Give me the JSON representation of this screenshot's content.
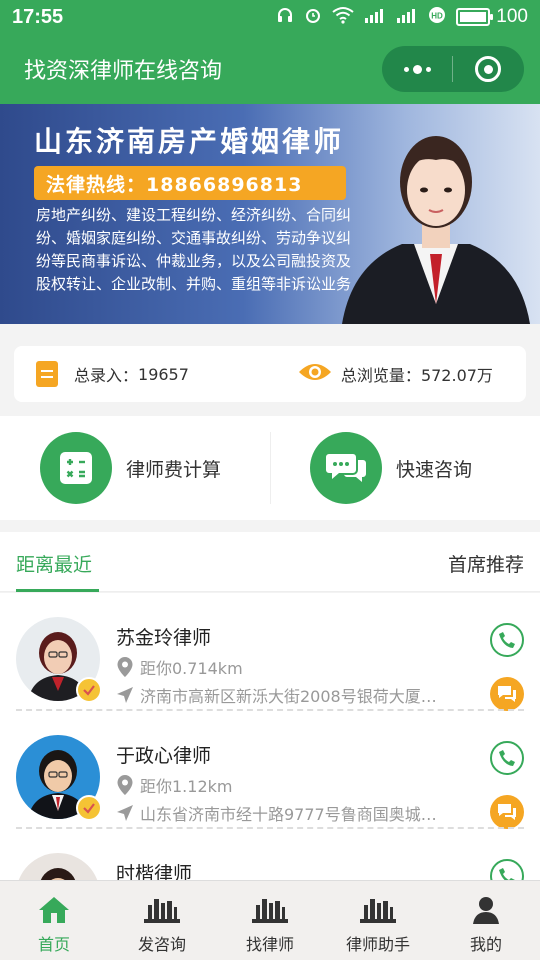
{
  "status_bar": {
    "time": "17:55",
    "battery": "100"
  },
  "header": {
    "title": "找资深律师在线咨询"
  },
  "banner": {
    "title": "山东济南房产婚姻律师",
    "hotline": "法律热线：18866896813",
    "description": "房地产纠纷、建设工程纠纷、经济纠纷、合同纠纷、婚姻家庭纠纷、交通事故纠纷、劳动争议纠纷等民商事诉讼、仲裁业务，以及公司融投资及股权转让、企业改制、并购、重组等非诉讼业务",
    "slide_count": 9,
    "active_slide": 0
  },
  "stats": {
    "records_label": "总录入：",
    "records_value": "19657",
    "views_label": "总浏览量：",
    "views_value": "572.07万"
  },
  "actions": [
    {
      "label": "律师费计算",
      "icon": "calculator-icon"
    },
    {
      "label": "快速咨询",
      "icon": "chat-bubbles-icon"
    }
  ],
  "tabs": {
    "nearest": "距离最近",
    "recommended": "首席推荐"
  },
  "lawyers": [
    {
      "name": "苏金玲律师",
      "distance": "距你0.714km",
      "address": "济南市高新区新泺大街2008号银荷大厦…"
    },
    {
      "name": "于政心律师",
      "distance": "距你1.12km",
      "address": "山东省济南市经十路9777号鲁商国奥城…"
    },
    {
      "name": "时楷律师",
      "distance": "",
      "address": ""
    }
  ],
  "bottom_nav": [
    {
      "label": "首页",
      "icon": "home-icon"
    },
    {
      "label": "发咨询",
      "icon": "books-icon"
    },
    {
      "label": "找律师",
      "icon": "books-icon"
    },
    {
      "label": "律师助手",
      "icon": "books-icon"
    },
    {
      "label": "我的",
      "icon": "person-icon"
    }
  ],
  "colors": {
    "primary": "#37a95a",
    "accent": "#f5a623"
  }
}
